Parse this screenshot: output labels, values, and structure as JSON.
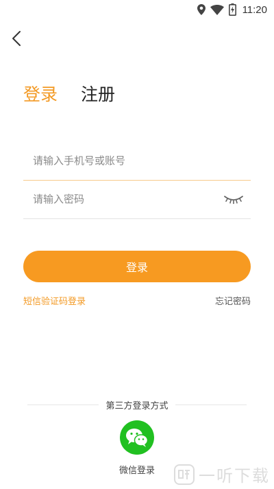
{
  "status_bar": {
    "time": "11:20",
    "icons": [
      "location-icon",
      "wifi-icon",
      "battery-icon"
    ]
  },
  "nav": {
    "back_icon": "chevron-left-icon"
  },
  "tabs": [
    {
      "label": "登录",
      "active": true
    },
    {
      "label": "注册",
      "active": false
    }
  ],
  "form": {
    "phone_placeholder": "请输入手机号或账号",
    "phone_value": "",
    "password_placeholder": "请输入密码",
    "password_value": "",
    "password_toggle_icon": "eye-closed-icon"
  },
  "login_button": "登录",
  "links": {
    "sms_login": "短信验证码登录",
    "forgot_password": "忘记密码"
  },
  "third_party": {
    "title": "第三方登录方式",
    "wechat_label": "微信登录",
    "wechat_icon": "wechat-icon"
  },
  "watermark": {
    "text": "一听下载"
  },
  "colors": {
    "accent": "#f79a21",
    "wechat": "#21c021"
  }
}
